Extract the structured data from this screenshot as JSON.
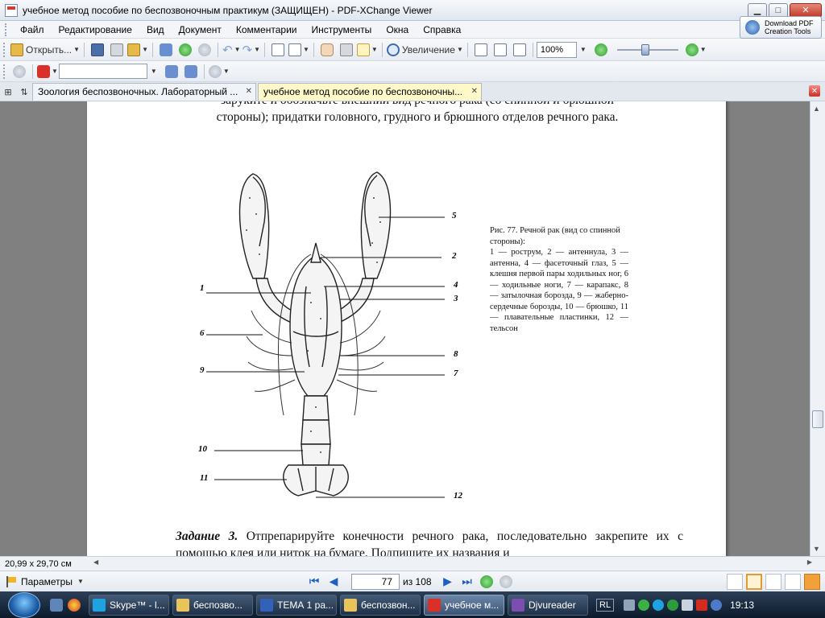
{
  "window": {
    "title": "учебное метод пособие по беспозвоночным практикум (ЗАЩИЩЕН) - PDF-XChange Viewer",
    "min": "▁",
    "max": "□",
    "close": "✕"
  },
  "menu": [
    "Файл",
    "Редактирование",
    "Вид",
    "Документ",
    "Комментарии",
    "Инструменты",
    "Окна",
    "Справка"
  ],
  "download_tools": {
    "line1": "Download PDF",
    "line2": "Creation Tools"
  },
  "toolbar": {
    "open_label": "Открыть...",
    "zoom_label": "Увеличение",
    "zoom_value": "100%",
    "zoom_slider_fraction": 0.45,
    "search_value": ""
  },
  "tabs": [
    {
      "label": "Зоология беспозвоночных. Лабораторный ...",
      "active": false
    },
    {
      "label": "учебное метод пособие по беспозвоночны...",
      "active": true
    }
  ],
  "document": {
    "top_line1": "заруките и обозначьте внешний вид речного рака (со спинной и брюшной",
    "top_line2": "стороны); придатки головного, грудного и брюшного отделов речного рака.",
    "figure_labels": [
      "1",
      "2",
      "3",
      "4",
      "5",
      "6",
      "7",
      "8",
      "9",
      "10",
      "11",
      "12"
    ],
    "caption_title": "Рис. 77. Речной рак (вид со спинной стороны):",
    "caption_body": "1 — рострум, 2 — антеннула, 3 — антенна, 4 — фасеточный глаз, 5 — клешня первой пары ходильных ног, 6 — ходильные ноги, 7 — карапакс, 8 — затылочная борозда, 9 — жаберно-сердечные борозды, 10 — брюшко, 11 — плавательные пластинки, 12 — тельсон",
    "task_head": "Задание 3.",
    "task_text": " Отпрепарируйте конечности речного рака, последовательно закрепите их с помощью клея или ниток на бумаге. Подпишите их названия и"
  },
  "status": {
    "page_size": "20,99 x 29,70 см"
  },
  "nav": {
    "params_label": "Параметры",
    "current_page": "77",
    "of_label": "из 108"
  },
  "taskbar": {
    "items": [
      {
        "label": "Skype™ - l...",
        "color": "#1fa3e0",
        "active": false
      },
      {
        "label": "беспозво...",
        "color": "#e8c45a",
        "active": false
      },
      {
        "label": "ТЕМА 1 ра...",
        "color": "#2f62b8",
        "active": false
      },
      {
        "label": "беспозвон...",
        "color": "#e8c45a",
        "active": false
      },
      {
        "label": "учебное м...",
        "color": "#d9312a",
        "active": true
      },
      {
        "label": "Djvureader",
        "color": "#7a4fb0",
        "active": false
      }
    ],
    "lang": "RL",
    "clock": "19:13"
  }
}
